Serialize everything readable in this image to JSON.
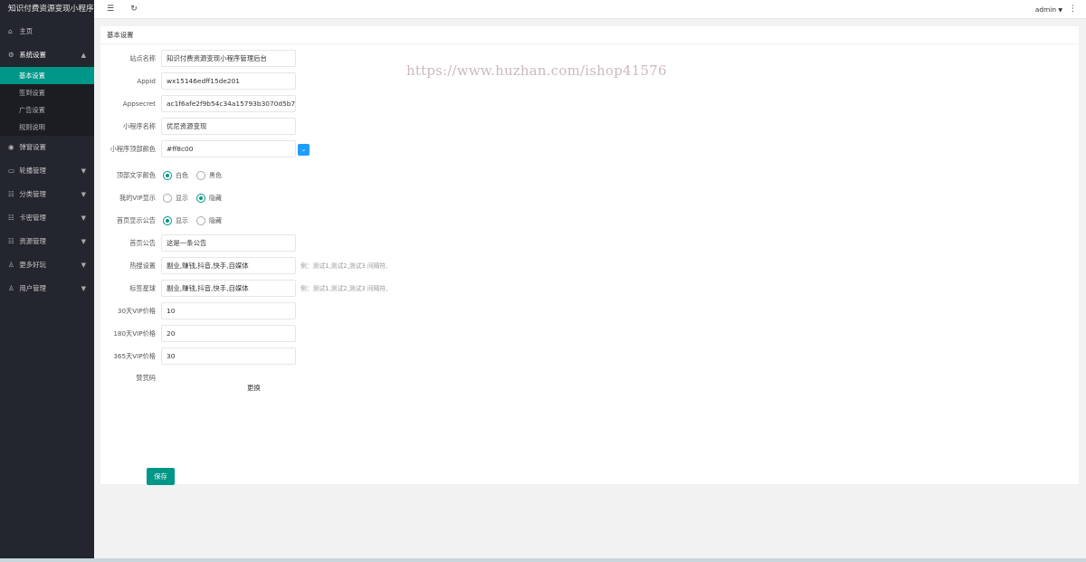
{
  "app": {
    "title": "知识付费资源变现小程序"
  },
  "topbar": {
    "menu_toggle_icon": "☰",
    "refresh_icon": "↻",
    "user": "admin",
    "more_icon": "⋮"
  },
  "sidebar": {
    "home": {
      "icon": "⌂",
      "label": "主页"
    },
    "system": {
      "icon": "⚙",
      "label": "系统设置",
      "arrow": "▲"
    },
    "sub_items": [
      "基本设置",
      "签到设置",
      "广告设置",
      "规则说明"
    ],
    "items": [
      {
        "icon": "◉",
        "label": "弹窗设置",
        "arrow": ""
      },
      {
        "icon": "▭",
        "label": "轮播管理",
        "arrow": "▼"
      },
      {
        "icon": "☷",
        "label": "分类管理",
        "arrow": "▼"
      },
      {
        "icon": "☷",
        "label": "卡密管理",
        "arrow": "▼"
      },
      {
        "icon": "☷",
        "label": "资源管理",
        "arrow": "▼"
      },
      {
        "icon": "♙",
        "label": "更多好玩",
        "arrow": "▼"
      },
      {
        "icon": "♙",
        "label": "用户管理",
        "arrow": "▼"
      }
    ]
  },
  "card": {
    "title": "基本设置"
  },
  "watermark": "https://www.huzhan.com/ishop41576",
  "form": {
    "site_name": {
      "label": "站点名称",
      "value": "知识付费资源变现小程序管理后台"
    },
    "appid": {
      "label": "Appid",
      "value": "wx15146edff15de201"
    },
    "appsecret": {
      "label": "Appsecret",
      "value": "ac1f6afe2f9b54c34a15793b3070d5b7"
    },
    "mp_name": {
      "label": "小程序名称",
      "value": "优尼资源变现"
    },
    "top_color": {
      "label": "小程序顶部颜色",
      "value": "#ff8c00",
      "btn_icon": "⌄"
    },
    "top_text_color": {
      "label": "顶部文字颜色",
      "options": [
        "白色",
        "黑色"
      ],
      "selected": 0
    },
    "my_vip": {
      "label": "我的VIP显示",
      "options": [
        "显示",
        "隐藏"
      ],
      "selected": 1
    },
    "home_notice_show": {
      "label": "首页显示公告",
      "options": [
        "显示",
        "隐藏"
      ],
      "selected": 0
    },
    "home_notice": {
      "label": "首页公告",
      "value": "这是一条公告"
    },
    "hot_search": {
      "label": "热搜设置",
      "value": "副业,赚钱,抖音,快手,自媒体",
      "hint": "例：测试1,测试2,测试3 间隔符,"
    },
    "tag_ball": {
      "label": "标签星球",
      "value": "副业,赚钱,抖音,快手,自媒体",
      "hint": "例：测试1,测试2,测试3 间隔符,"
    },
    "vip30": {
      "label": "30天VIP价格",
      "value": "10"
    },
    "vip180": {
      "label": "180天VIP价格",
      "value": "20"
    },
    "vip365": {
      "label": "365天VIP价格",
      "value": "30"
    },
    "reward_code": {
      "label": "赞赏码",
      "change": "更换"
    },
    "save": "保存"
  },
  "colors": {
    "sidebar": "#23262e",
    "accent": "#009688",
    "blue": "#1E9FFF"
  }
}
